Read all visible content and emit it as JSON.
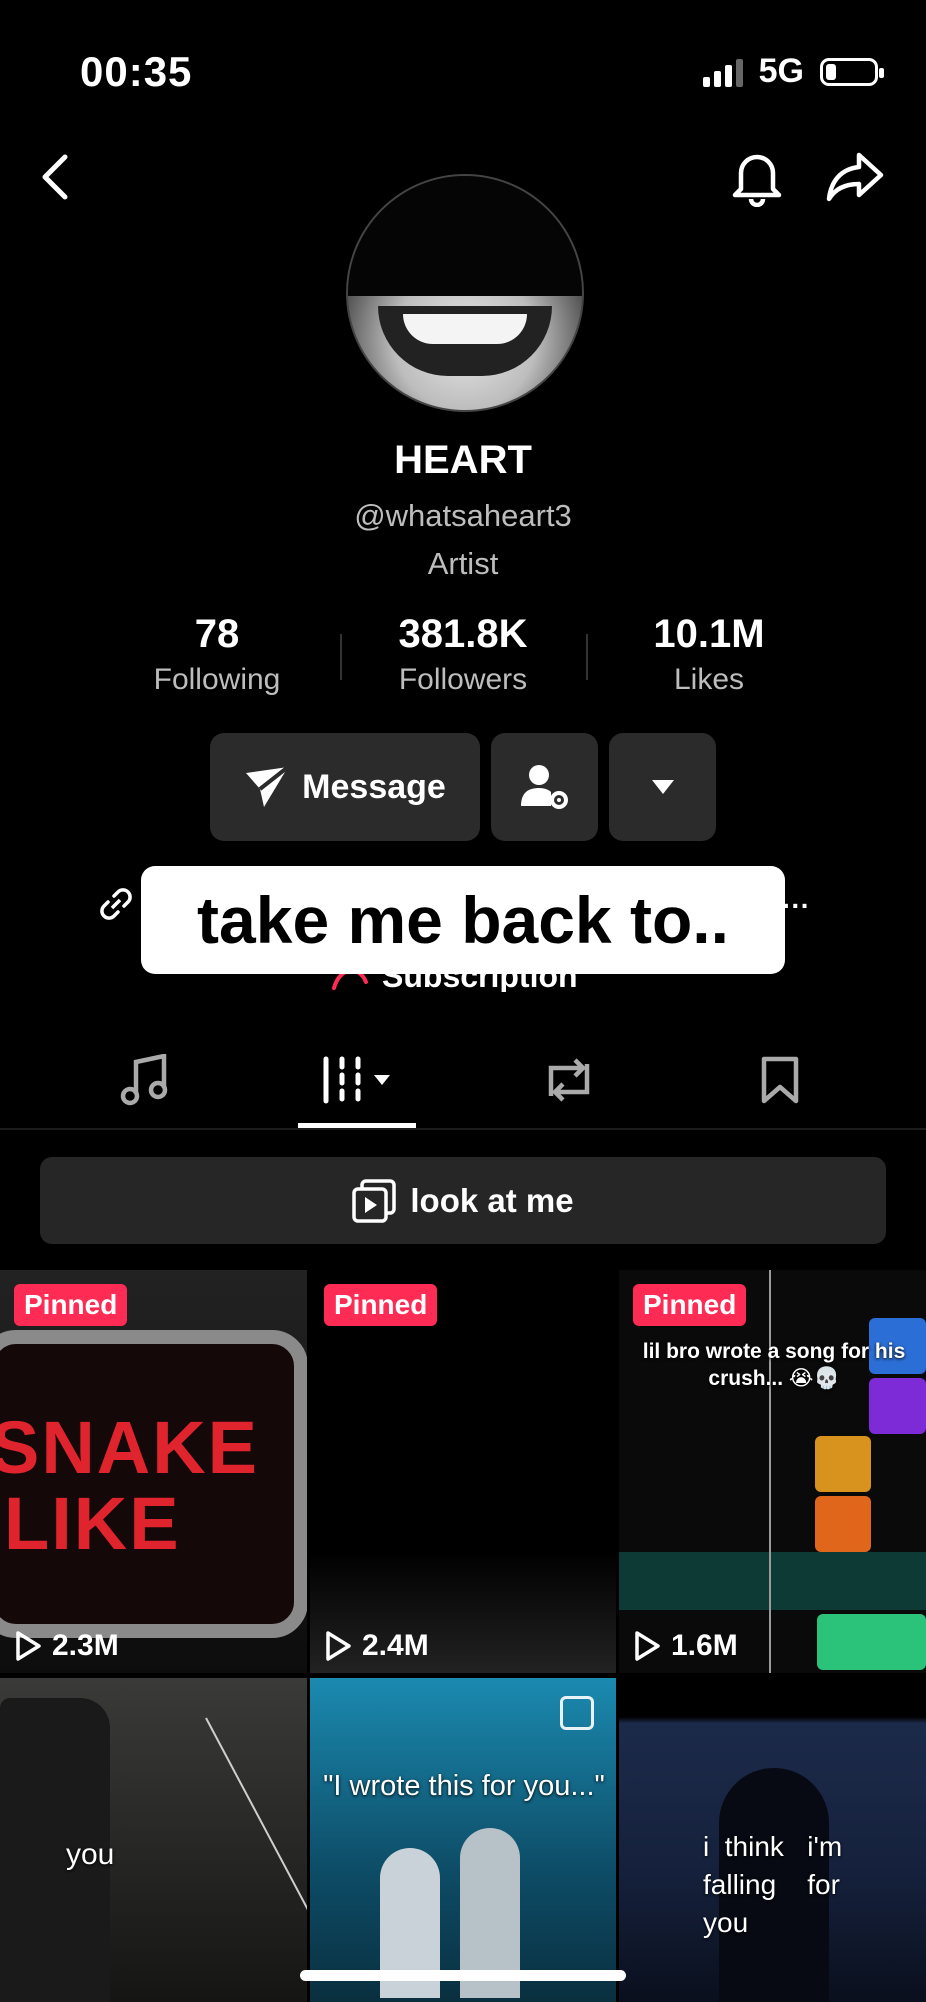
{
  "status_bar": {
    "time": "00:35",
    "network": "5G"
  },
  "profile": {
    "name": "HEART",
    "handle": "@whatsaheart3",
    "category": "Artist"
  },
  "stats": [
    {
      "value": "78",
      "label": "Following"
    },
    {
      "value": "381.8K",
      "label": "Followers"
    },
    {
      "value": "10.1M",
      "label": "Likes"
    }
  ],
  "actions": {
    "message_label": "Message"
  },
  "caption_overlay": "take me back to..",
  "subscription_label": "Subscription",
  "playlist": {
    "label": "look at me"
  },
  "videos": [
    {
      "pinned": "Pinned",
      "views": "2.3M",
      "art_text": [
        "SNAKE",
        "LIKE"
      ]
    },
    {
      "pinned": "Pinned",
      "views": "2.4M"
    },
    {
      "pinned": "Pinned",
      "views": "1.6M",
      "overlay_text": "lil bro wrote a song for his crush... 😭💀"
    },
    {
      "overlay_text": "you"
    },
    {
      "overlay_text": "\"I wrote this for you...\""
    },
    {
      "overlay_text": "i  think   i'm falling    for you"
    }
  ],
  "colors": {
    "background": "#000000",
    "pinned_badge": "#fe2c55",
    "button_bg": "#2b2b2b"
  }
}
